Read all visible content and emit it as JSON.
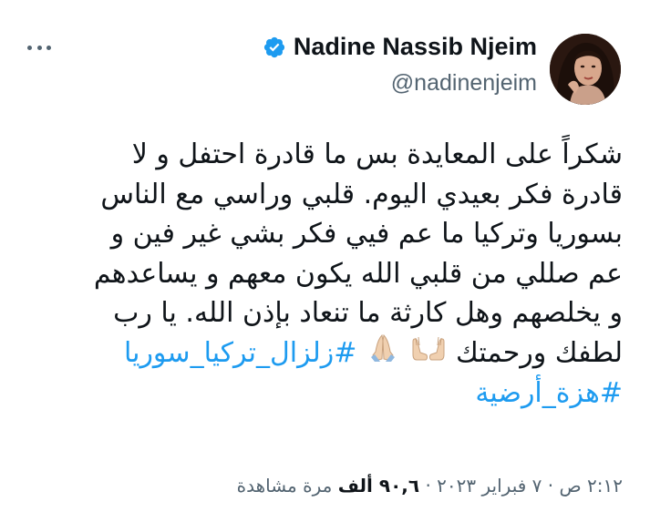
{
  "author": {
    "display_name": "Nadine Nassib Njeim",
    "handle": "@nadinenjeim",
    "verified": true,
    "avatar_icon": "profile-photo"
  },
  "tweet": {
    "lines": [
      "شكراً على المعايدة بس ما قادرة احتفل و لا",
      "قادرة فكر بعيدي اليوم. قلبي وراسي مع الناس",
      "بسوريا وتركيا ما عم فيي فكر بشي غير فين و",
      "عم صللي من قلبي الله يكون معهم و يساعدهم",
      "و يخلصهم وهل كارثة ما تنعاد بإذن الله. يا رب"
    ],
    "last_line_text": "لطفك ورحمتك",
    "emojis": [
      "palms-up-together-icon",
      "folded-hands-icon"
    ],
    "hashtags": [
      "#زلزال_تركيا_سوريا",
      "#هزة_أرضية"
    ]
  },
  "meta": {
    "time": "٢:١٢ ص",
    "separator": "·",
    "date": "٧ فبراير ٢٠٢٣",
    "views_count": "٩٠,٦ ألف",
    "views_label": "مرة مشاهدة"
  },
  "colors": {
    "accent": "#1d9bf0",
    "secondary_text": "#536471",
    "primary_text": "#0f1419"
  }
}
